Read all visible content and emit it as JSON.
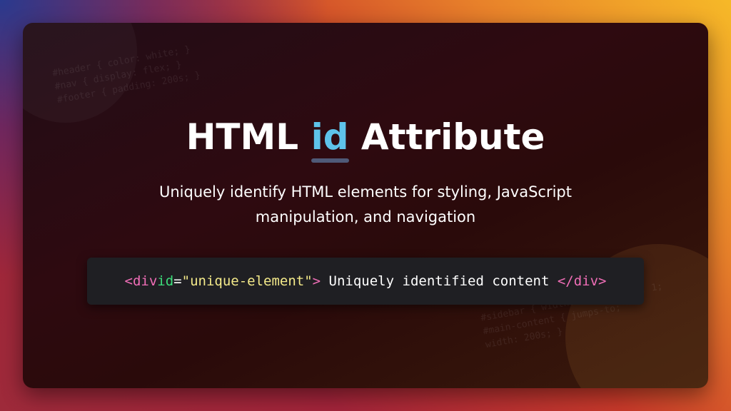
{
  "title": {
    "before": "HTML ",
    "highlight": "id",
    "after": " Attribute"
  },
  "subtitle": "Uniquely identify HTML elements for styling, JavaScript manipulation, and navigation",
  "code": {
    "open_tag": "<div",
    "attr_name": "id",
    "equals": "=",
    "attr_value": "\"unique-element\"",
    "open_close": ">",
    "content": " Uniquely identified content ",
    "close_tag": "</div>"
  },
  "decorative_code": {
    "top_left": [
      "#header { color: white; }",
      "#nav { display: flex; }",
      "#footer { padding: 200s; }"
    ],
    "bottom_right": [
      "#sidebar { width: 300px; flex: 1;",
      "#main-content { jumps-to;",
      "width: 200s; }"
    ]
  },
  "colors": {
    "highlight": "#5ec3ea",
    "tag": "#f06eb7",
    "attr": "#3ddc7a",
    "string": "#f4ea8a",
    "code_bg": "#1f1f23"
  }
}
